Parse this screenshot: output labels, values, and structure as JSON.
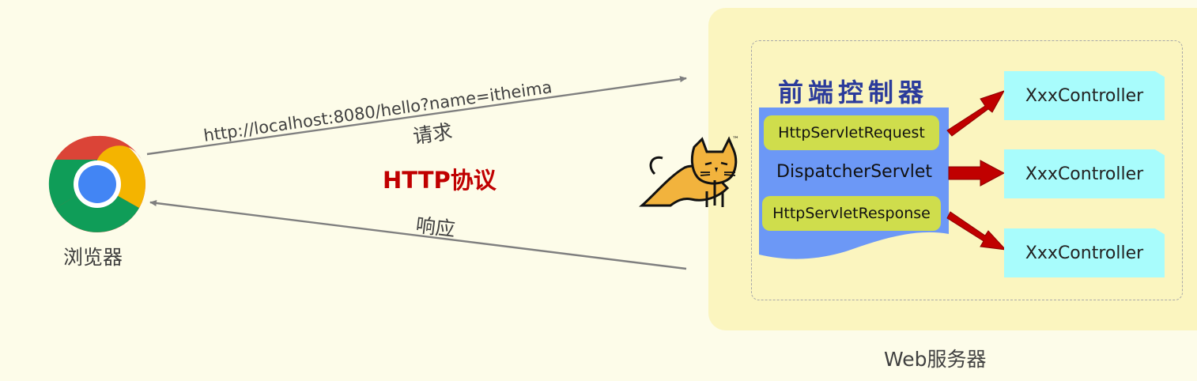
{
  "browser": {
    "label": "浏览器"
  },
  "request": {
    "url": "http://localhost:8080/hello?name=itheima",
    "label": "请求"
  },
  "protocol": {
    "label": "HTTP协议"
  },
  "response": {
    "label": "响应"
  },
  "server": {
    "label": "Web服务器",
    "front_controller_title": "前端控制器",
    "request_object": "HttpServletRequest",
    "dispatcher": "DispatcherServlet",
    "response_object": "HttpServletResponse",
    "controllers": [
      "XxxController",
      "XxxController",
      "XxxController"
    ],
    "tomcat_mark": "™"
  },
  "colors": {
    "background": "#FDFCE9",
    "server_panel": "#FBF5BF",
    "dispatcher_panel": "#6C98F6",
    "pill": "#CFDD4C",
    "controller": "#A8FCFC",
    "arrow_red": "#C00000",
    "protocol_text": "#C00000",
    "title_blue": "#2B3B9B"
  }
}
